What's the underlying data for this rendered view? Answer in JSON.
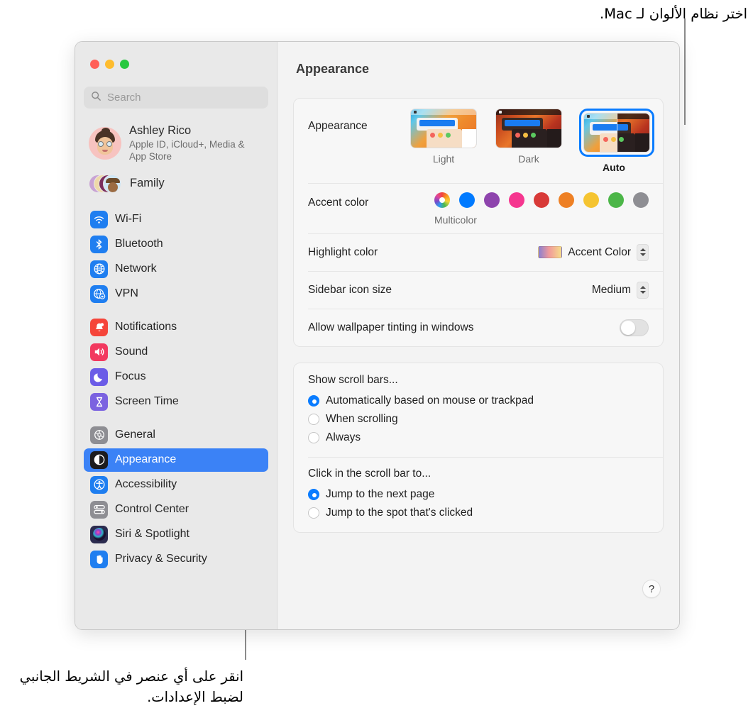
{
  "annotations": {
    "top": "اختر نظام الألوان لـ Mac.",
    "bottom": "انقر على أي عنصر في الشريط الجانبي لضبط الإعدادات."
  },
  "window": {
    "traffic_lights": [
      "close",
      "minimize",
      "zoom"
    ]
  },
  "search": {
    "placeholder": "Search",
    "value": ""
  },
  "account": {
    "name": "Ashley Rico",
    "subtitle": "Apple ID, iCloud+, Media & App Store",
    "family_label": "Family"
  },
  "sidebar": {
    "groups": [
      {
        "items": [
          {
            "label": "Wi-Fi",
            "icon": "wifi-icon",
            "color": "#1f7ef0",
            "selected": false
          },
          {
            "label": "Bluetooth",
            "icon": "bluetooth-icon",
            "color": "#1f7ef0",
            "selected": false
          },
          {
            "label": "Network",
            "icon": "globe-icon",
            "color": "#1f7ef0",
            "selected": false
          },
          {
            "label": "VPN",
            "icon": "vpn-globe-icon",
            "color": "#1f7ef0",
            "selected": false
          }
        ]
      },
      {
        "items": [
          {
            "label": "Notifications",
            "icon": "bell-icon",
            "color": "#f5453a",
            "selected": false
          },
          {
            "label": "Sound",
            "icon": "speaker-icon",
            "color": "#f2395f",
            "selected": false
          },
          {
            "label": "Focus",
            "icon": "moon-icon",
            "color": "#6b5ce7",
            "selected": false
          },
          {
            "label": "Screen Time",
            "icon": "hourglass-icon",
            "color": "#7b62e0",
            "selected": false
          }
        ]
      },
      {
        "items": [
          {
            "label": "General",
            "icon": "gear-icon",
            "color": "#8e8e93",
            "selected": false
          },
          {
            "label": "Appearance",
            "icon": "appearance-icon",
            "color": "#1c1c1e",
            "selected": true
          },
          {
            "label": "Accessibility",
            "icon": "accessibility-icon",
            "color": "#1f7ef0",
            "selected": false
          },
          {
            "label": "Control Center",
            "icon": "control-center-icon",
            "color": "#8e8e93",
            "selected": false
          },
          {
            "label": "Siri & Spotlight",
            "icon": "siri-icon",
            "color": "#2b2b4f",
            "selected": false
          },
          {
            "label": "Privacy & Security",
            "icon": "hand-icon",
            "color": "#1f7ef0",
            "selected": false
          }
        ]
      }
    ]
  },
  "content": {
    "title": "Appearance",
    "appearance": {
      "label": "Appearance",
      "options": [
        {
          "caption": "Light",
          "selected": false
        },
        {
          "caption": "Dark",
          "selected": false
        },
        {
          "caption": "Auto",
          "selected": true
        }
      ]
    },
    "accent": {
      "label": "Accent color",
      "caption": "Multicolor",
      "colors": [
        "multicolor",
        "#007aff",
        "#8e44ad",
        "#f5368f",
        "#d83a38",
        "#ee8024",
        "#f5c431",
        "#4cb648",
        "#8e8e93"
      ],
      "selected_index": 0
    },
    "highlight": {
      "label": "Highlight color",
      "value": "Accent Color"
    },
    "sidebar_icon_size": {
      "label": "Sidebar icon size",
      "value": "Medium"
    },
    "wallpaper_tinting": {
      "label": "Allow wallpaper tinting in windows",
      "on": false
    },
    "scroll_bars": {
      "heading": "Show scroll bars...",
      "options": [
        {
          "label": "Automatically based on mouse or trackpad",
          "selected": true
        },
        {
          "label": "When scrolling",
          "selected": false
        },
        {
          "label": "Always",
          "selected": false
        }
      ]
    },
    "scroll_click": {
      "heading": "Click in the scroll bar to...",
      "options": [
        {
          "label": "Jump to the next page",
          "selected": true
        },
        {
          "label": "Jump to the spot that's clicked",
          "selected": false
        }
      ]
    },
    "help_label": "?"
  }
}
